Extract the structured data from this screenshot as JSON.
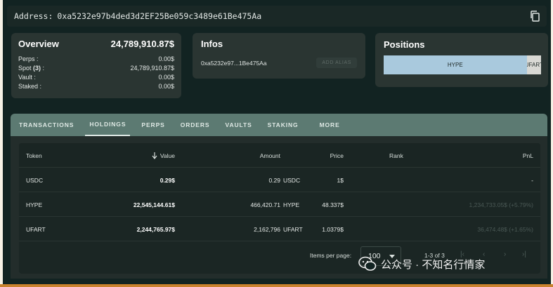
{
  "address": {
    "label": "Address:",
    "value": "0xa5232e97b4ded3d2EF25Be059c3489e61Be475Aa"
  },
  "overview": {
    "title": "Overview",
    "total": "24,789,910.87$",
    "rows": [
      {
        "label": "Perps :",
        "value": "0.00$"
      },
      {
        "label": "Spot (3) :",
        "value": "24,789,910.87$"
      },
      {
        "label": "Vault :",
        "value": "0.00$"
      },
      {
        "label": "Staked :",
        "value": "0.00$"
      }
    ]
  },
  "infos": {
    "title": "Infos",
    "short_address": "0xa5232e97...1Be475Aa",
    "alias_button": "ADD ALIAS"
  },
  "positions": {
    "title": "Positions",
    "segments": [
      {
        "label": "HYPE",
        "share": 0.909,
        "color": "#a9c9dd"
      },
      {
        "label": "UFART",
        "share": 0.091,
        "color": "#d9d9d4"
      }
    ]
  },
  "tabs": [
    {
      "label": "TRANSACTIONS",
      "active": false
    },
    {
      "label": "HOLDINGS",
      "active": true
    },
    {
      "label": "PERPS",
      "active": false
    },
    {
      "label": "ORDERS",
      "active": false
    },
    {
      "label": "VAULTS",
      "active": false
    },
    {
      "label": "STAKING",
      "active": false
    },
    {
      "label": "MORE",
      "active": false
    }
  ],
  "table": {
    "headers": {
      "token": "Token",
      "value": "Value",
      "amount": "Amount",
      "price": "Price",
      "rank": "Rank",
      "pnl": "PnL"
    },
    "rows": [
      {
        "token": "USDC",
        "value": "0.29$",
        "amount": "0.29",
        "unit": "USDC",
        "price": "1$",
        "rank": "",
        "pnl": "-"
      },
      {
        "token": "HYPE",
        "value": "22,545,144.61$",
        "amount": "466,420.71",
        "unit": "HYPE",
        "price": "48.337$",
        "rank": "",
        "pnl": "1,234,733.05$ (+5.79%)"
      },
      {
        "token": "UFART",
        "value": "2,244,765.97$",
        "amount": "2,162,796",
        "unit": "UFART",
        "price": "1.0379$",
        "rank": "",
        "pnl": "36,474.48$ (+1.65%)"
      }
    ]
  },
  "pagination": {
    "items_per_page_label": "Items per page:",
    "items_per_page_value": "100",
    "range": "1-3 of 3"
  },
  "watermark": {
    "text": "公众号 · 不知名行情家"
  }
}
